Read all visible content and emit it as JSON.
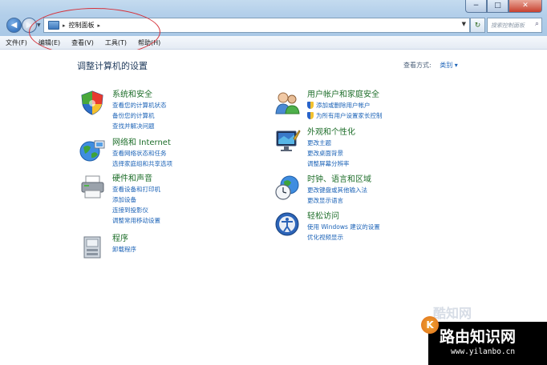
{
  "window": {
    "controls": {
      "minimize": "−",
      "maximize": "□",
      "close": "✕"
    }
  },
  "nav": {
    "address_segment": "控制面板",
    "search_placeholder": "搜索控制面板"
  },
  "menu": [
    "文件(F)",
    "编辑(E)",
    "查看(V)",
    "工具(T)",
    "帮助(H)"
  ],
  "page": {
    "title": "调整计算机的设置",
    "view_by_label": "查看方式:",
    "view_by_value": "类别 ▾"
  },
  "categories_left": [
    {
      "icon": "shield-flag-icon",
      "title": "系统和安全",
      "links": [
        "查看您的计算机状态",
        "备份您的计算机",
        "查找并解决问题"
      ]
    },
    {
      "icon": "network-globe-icon",
      "title": "网络和 Internet",
      "links": [
        "查看网络状态和任务",
        "选择家庭组和共享选项"
      ]
    },
    {
      "icon": "printer-icon",
      "title": "硬件和声音",
      "links": [
        "查看设备和打印机",
        "添加设备",
        "连接到投影仪",
        "调整常用移动设置"
      ]
    },
    {
      "icon": "programs-icon",
      "title": "程序",
      "links": [
        "卸载程序"
      ]
    }
  ],
  "categories_right": [
    {
      "icon": "users-icon",
      "title": "用户帐户和家庭安全",
      "links": [
        "添加或删除用户帐户",
        "为所有用户设置家长控制"
      ],
      "shielded": [
        true,
        true
      ]
    },
    {
      "icon": "appearance-monitor-icon",
      "title": "外观和个性化",
      "links": [
        "更改主题",
        "更改桌面背景",
        "调整屏幕分辨率"
      ]
    },
    {
      "icon": "clock-globe-icon",
      "title": "时钟、语言和区域",
      "links": [
        "更改键盘或其他输入法",
        "更改显示语言"
      ]
    },
    {
      "icon": "ease-of-access-icon",
      "title": "轻松访问",
      "links": [
        "使用 Windows 建议的设置",
        "优化视频显示"
      ]
    }
  ],
  "watermark": {
    "logo_text": "酷知网",
    "title": "路由知识网",
    "url": "www.yilanbo.cn",
    "badge": "K"
  }
}
